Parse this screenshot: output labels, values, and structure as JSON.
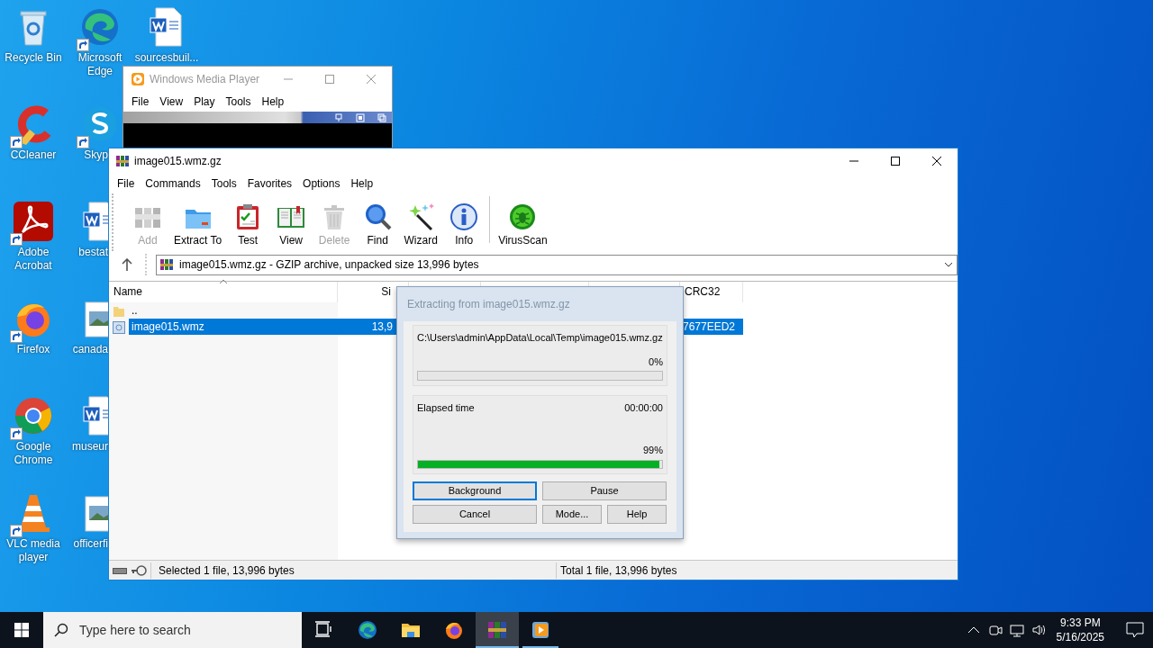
{
  "desktop_icons": [
    {
      "label": "Recycle Bin",
      "kind": "recycle",
      "shortcut": false
    },
    {
      "label": "CCleaner",
      "kind": "ccleaner",
      "shortcut": true
    },
    {
      "label": "Adobe Acrobat",
      "kind": "acrobat",
      "shortcut": true
    },
    {
      "label": "Firefox",
      "kind": "firefox",
      "shortcut": true
    },
    {
      "label": "Google Chrome",
      "kind": "chrome",
      "shortcut": true
    },
    {
      "label": "VLC media player",
      "kind": "vlc",
      "shortcut": true
    },
    {
      "label": "Microsoft Edge",
      "kind": "edge",
      "shortcut": true
    },
    {
      "label": "Skyp",
      "kind": "skype",
      "shortcut": true
    },
    {
      "label": "bestat",
      "kind": "word",
      "shortcut": false
    },
    {
      "label": "canada",
      "kind": "image",
      "shortcut": false
    },
    {
      "label": "museur",
      "kind": "word",
      "shortcut": false
    },
    {
      "label": "officerfi",
      "kind": "image",
      "shortcut": false
    },
    {
      "label": "sourcesbuil...",
      "kind": "word",
      "shortcut": false
    }
  ],
  "media_player": {
    "title": "Windows Media Player",
    "menu": [
      "File",
      "View",
      "Play",
      "Tools",
      "Help"
    ]
  },
  "archiver": {
    "title": "image015.wmz.gz",
    "menu": [
      "File",
      "Commands",
      "Tools",
      "Favorites",
      "Options",
      "Help"
    ],
    "toolbar": [
      {
        "label": "Add",
        "kind": "add",
        "disabled": true
      },
      {
        "label": "Extract To",
        "kind": "extract",
        "disabled": false
      },
      {
        "label": "Test",
        "kind": "test",
        "disabled": false
      },
      {
        "label": "View",
        "kind": "view",
        "disabled": false
      },
      {
        "label": "Delete",
        "kind": "delete",
        "disabled": true
      },
      {
        "label": "Find",
        "kind": "find",
        "disabled": false
      },
      {
        "label": "Wizard",
        "kind": "wizard",
        "disabled": false
      },
      {
        "label": "Info",
        "kind": "info",
        "disabled": false
      },
      {
        "label": "VirusScan",
        "kind": "virusscan",
        "disabled": false
      }
    ],
    "address": "image015.wmz.gz - GZIP archive, unpacked size 13,996 bytes",
    "columns": [
      {
        "label": "Name",
        "sorted": true
      },
      {
        "label": "Si",
        "sorted": false
      },
      {
        "label": "CRC32",
        "sorted": false
      }
    ],
    "rows": [
      {
        "kind": "folder",
        "name": "..",
        "selected": false
      },
      {
        "kind": "file",
        "name": "image015.wmz",
        "size": "13,9",
        "crc32": "7677EED2",
        "selected": true
      }
    ],
    "status": {
      "selected": "Selected 1 file, 13,996 bytes",
      "total": "Total 1 file, 13,996 bytes"
    }
  },
  "progress_dialog": {
    "title": "Extracting from image015.wmz.gz",
    "file_path": "C:\\Users\\admin\\AppData\\Local\\Temp\\image015.wmz.gz",
    "file_percent": "0%",
    "file_progress": {
      "level": 0
    },
    "elapsed_label": "Elapsed time",
    "elapsed": "00:00:00",
    "total_percent": "99%",
    "total_progress": {
      "level": 0.99
    },
    "buttons": [
      {
        "label": "Background",
        "focused": true
      },
      {
        "label": "Pause",
        "focused": false
      },
      {
        "label": "Cancel",
        "focused": false
      },
      {
        "label": "Mode...",
        "focused": false
      },
      {
        "label": "Help",
        "focused": false
      }
    ]
  },
  "taskbar": {
    "search": {
      "placeholder": "Type here to search"
    },
    "apps": [
      {
        "kind": "taskview",
        "running": false,
        "selected": false
      },
      {
        "kind": "edge",
        "running": false,
        "selected": false
      },
      {
        "kind": "explorer",
        "running": false,
        "selected": false
      },
      {
        "kind": "firefox",
        "running": false,
        "selected": false
      },
      {
        "kind": "archiver",
        "running": true,
        "selected": true
      },
      {
        "kind": "player",
        "running": true,
        "selected": false
      }
    ],
    "time": "9:33 PM",
    "date": "5/16/2025"
  }
}
